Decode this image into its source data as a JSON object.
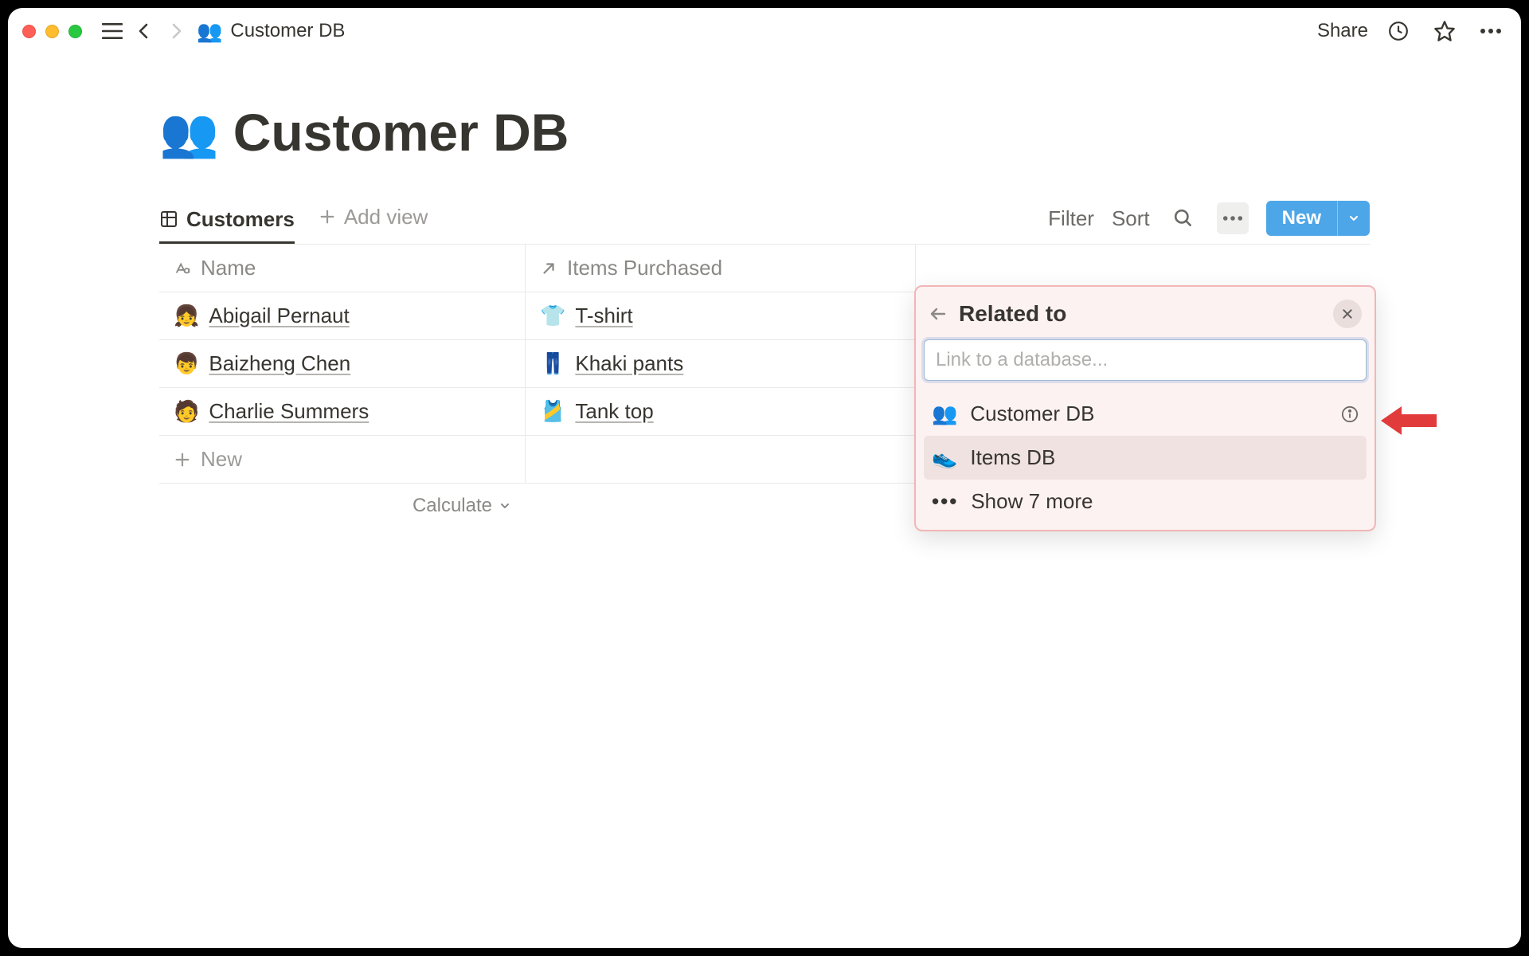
{
  "breadcrumb": {
    "icon": "👥",
    "title": "Customer DB"
  },
  "topbar": {
    "share": "Share"
  },
  "page": {
    "icon": "👥",
    "title": "Customer DB"
  },
  "views": {
    "active": "Customers",
    "add": "Add view"
  },
  "controls": {
    "filter": "Filter",
    "sort": "Sort",
    "new": "New"
  },
  "columns": {
    "name": "Name",
    "items": "Items Purchased"
  },
  "rows": [
    {
      "avatar": "👧",
      "name": "Abigail Pernaut",
      "item_icon": "👕",
      "item": "T-shirt"
    },
    {
      "avatar": "👦",
      "name": "Baizheng Chen",
      "item_icon": "👖",
      "item": "Khaki pants"
    },
    {
      "avatar": "🧑",
      "name": "Charlie Summers",
      "item_icon": "🎽",
      "item": "Tank top"
    }
  ],
  "newrow": "New",
  "calculate": "Calculate",
  "popover": {
    "title": "Related to",
    "placeholder": "Link to a database...",
    "options": [
      {
        "icon": "👥",
        "label": "Customer DB",
        "info": true
      },
      {
        "icon": "👟",
        "label": "Items DB",
        "hover": true
      }
    ],
    "more": "Show 7 more"
  }
}
